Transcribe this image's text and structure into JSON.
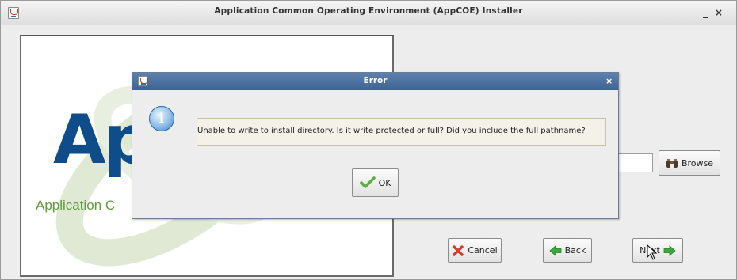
{
  "window": {
    "title": "Application Common Operating Environment (AppCOE) Installer",
    "minimize": "_",
    "close": "×"
  },
  "logo": {
    "big_text": "Ap",
    "sub_text": "Application C"
  },
  "buttons": {
    "browse": "Browse",
    "cancel": "Cancel",
    "back": "Back",
    "next": "Next"
  },
  "dialog": {
    "title": "Error",
    "close": "×",
    "message": "Unable to write to install directory. Is it write protected or full? Did you include the full pathname?",
    "ok": "OK",
    "info_glyph": "i"
  },
  "colors": {
    "logo_blue": "#0f4c8a",
    "logo_green": "#5f9b3c",
    "dialog_title_bg": "#3d6395"
  }
}
